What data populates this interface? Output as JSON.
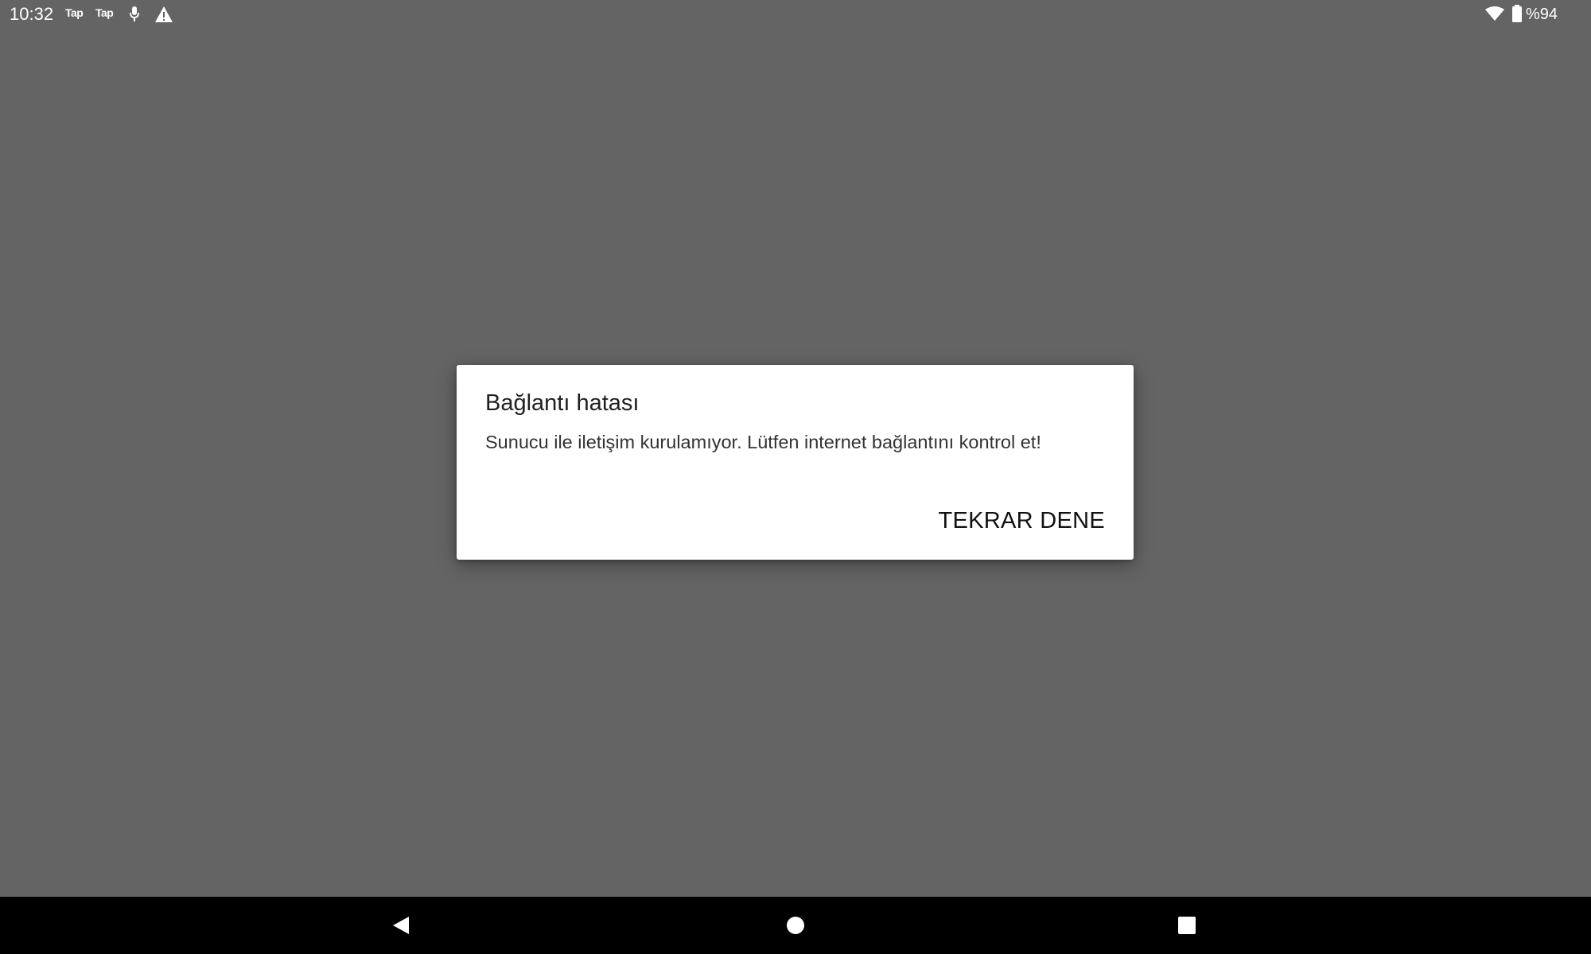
{
  "status_bar": {
    "time": "10:32",
    "notifications": [
      "Tap",
      "Tap"
    ],
    "icons": [
      "mic-icon",
      "warning-icon",
      "wifi-icon",
      "battery-icon"
    ],
    "battery_text": "%94",
    "battery_level": 0.94
  },
  "dialog": {
    "title": "Bağlantı hatası",
    "message": "Sunucu ile iletişim kurulamıyor. Lütfen internet bağlantını kontrol et!",
    "retry_label": "TEKRAR DENE"
  },
  "nav_bar": {
    "buttons": [
      "back-icon",
      "home-icon",
      "recents-icon"
    ]
  },
  "colors": {
    "scrim": "#646464",
    "dialog_bg": "#ffffff",
    "nav_bg": "#000000"
  }
}
